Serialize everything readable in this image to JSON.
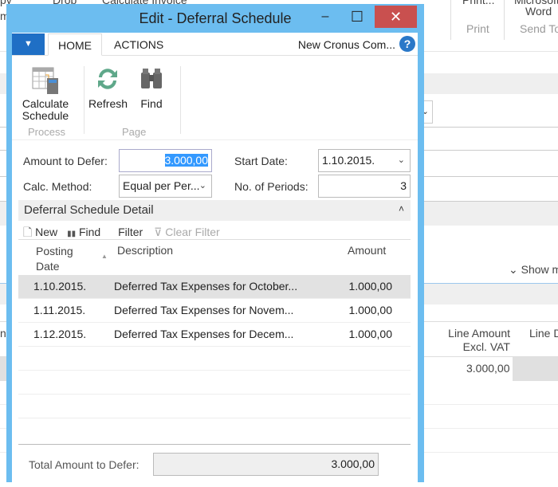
{
  "background": {
    "ribbon_fragments": [
      "py",
      "m",
      "Drop",
      "Calculate Invoice",
      "Print...",
      "Microsoft",
      "Word"
    ],
    "group_labels": [
      "Print",
      "Send To"
    ],
    "show_more": "Show m",
    "col_line_amount": "Line Amount Excl. VAT",
    "col_line_d": "Line D",
    "line_amount_value": "3.000,00",
    "left_fragment": "n"
  },
  "window": {
    "title": "Edit - Deferral Schedule",
    "minimize": "–",
    "maximize": "☐",
    "close": "✕"
  },
  "tabs": {
    "file": "▼",
    "home": "HOME",
    "actions": "ACTIONS",
    "company": "New Cronus Com...",
    "help": "?"
  },
  "ribbon": {
    "calculate_schedule": "Calculate Schedule",
    "process_group": "Process",
    "refresh": "Refresh",
    "find": "Find",
    "page_group": "Page"
  },
  "form": {
    "amount_label": "Amount to Defer:",
    "amount_value": "3.000,00",
    "start_date_label": "Start Date:",
    "start_date_value": "1.10.2015.",
    "calc_method_label": "Calc. Method:",
    "calc_method_value": "Equal per Per...",
    "periods_label": "No. of Periods:",
    "periods_value": "3"
  },
  "detail": {
    "title": "Deferral Schedule Detail",
    "collapse": "˄",
    "toolbar": {
      "new": "New",
      "find": "Find",
      "filter": "Filter",
      "clear_filter": "Clear Filter"
    },
    "columns": {
      "posting_date_1": "Posting",
      "posting_date_2": "Date",
      "description": "Description",
      "amount": "Amount"
    },
    "rows": [
      {
        "date": "1.10.2015.",
        "description": "Deferred Tax Expenses for October...",
        "amount": "1.000,00"
      },
      {
        "date": "1.11.2015.",
        "description": "Deferred Tax Expenses for Novem...",
        "amount": "1.000,00"
      },
      {
        "date": "1.12.2015.",
        "description": "Deferred Tax Expenses for Decem...",
        "amount": "1.000,00"
      }
    ]
  },
  "footer": {
    "total_label": "Total Amount to Defer:",
    "total_value": "3.000,00"
  }
}
